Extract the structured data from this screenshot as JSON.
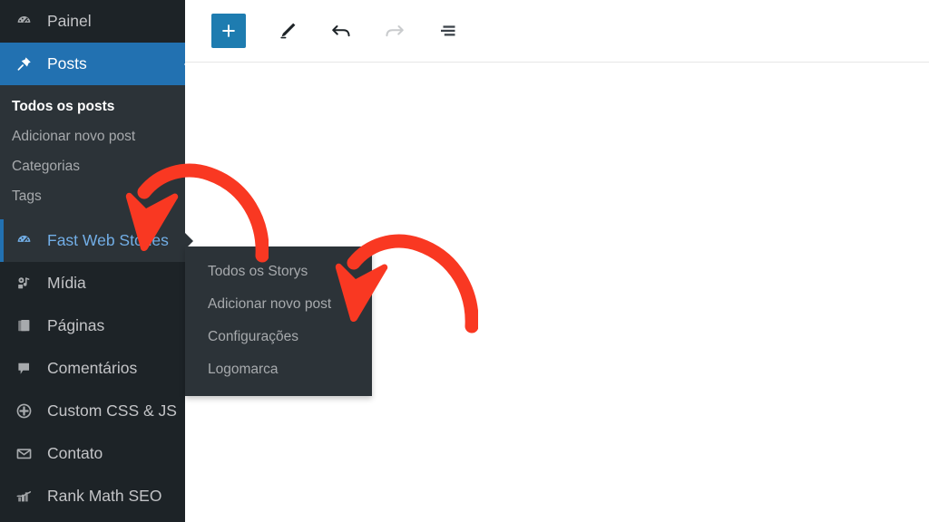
{
  "sidebar": {
    "items": [
      {
        "label": "Painel",
        "icon": "dashboard-icon",
        "state": "normal"
      },
      {
        "label": "Posts",
        "icon": "pin-icon",
        "state": "active"
      },
      {
        "label": "Fast Web Stories",
        "icon": "stories-dashboard-icon",
        "state": "open"
      },
      {
        "label": "Mídia",
        "icon": "media-icon",
        "state": "normal"
      },
      {
        "label": "Páginas",
        "icon": "pages-icon",
        "state": "normal"
      },
      {
        "label": "Comentários",
        "icon": "comments-icon",
        "state": "normal"
      },
      {
        "label": "Custom CSS & JS",
        "icon": "plus-circle-icon",
        "state": "normal"
      },
      {
        "label": "Contato",
        "icon": "envelope-icon",
        "state": "normal"
      },
      {
        "label": "Rank Math SEO",
        "icon": "rank-math-icon",
        "state": "normal"
      }
    ],
    "posts_submenu": [
      {
        "label": "Todos os posts",
        "current": true
      },
      {
        "label": "Adicionar novo post",
        "current": false
      },
      {
        "label": "Categorias",
        "current": false
      },
      {
        "label": "Tags",
        "current": false
      }
    ]
  },
  "flyout": {
    "items": [
      {
        "label": "Todos os Storys"
      },
      {
        "label": "Adicionar novo post"
      },
      {
        "label": "Configurações"
      },
      {
        "label": "Logomarca"
      }
    ]
  },
  "toolbar": {
    "buttons": [
      {
        "name": "add-block-button",
        "icon": "plus-icon",
        "state": "enabled"
      },
      {
        "name": "edit-tool-button",
        "icon": "pencil-icon",
        "state": "enabled"
      },
      {
        "name": "undo-button",
        "icon": "undo-arrow-icon",
        "state": "enabled"
      },
      {
        "name": "redo-button",
        "icon": "redo-arrow-icon",
        "state": "disabled"
      },
      {
        "name": "document-outline-button",
        "icon": "list-view-icon",
        "state": "enabled"
      }
    ]
  },
  "annotations": {
    "arrows": [
      {
        "name": "arrow-pointing-to-fast-web-stories",
        "color": "#f93822"
      },
      {
        "name": "arrow-pointing-to-adicionar-novo-post",
        "color": "#f93822"
      }
    ]
  },
  "colors": {
    "sidebar_bg": "#1d2327",
    "submenu_bg": "#2c3338",
    "active_blue": "#2271b1",
    "highlight_text": "#72aee6",
    "arrow_red": "#f93822",
    "toolbar_blue": "#1e7cb0"
  }
}
